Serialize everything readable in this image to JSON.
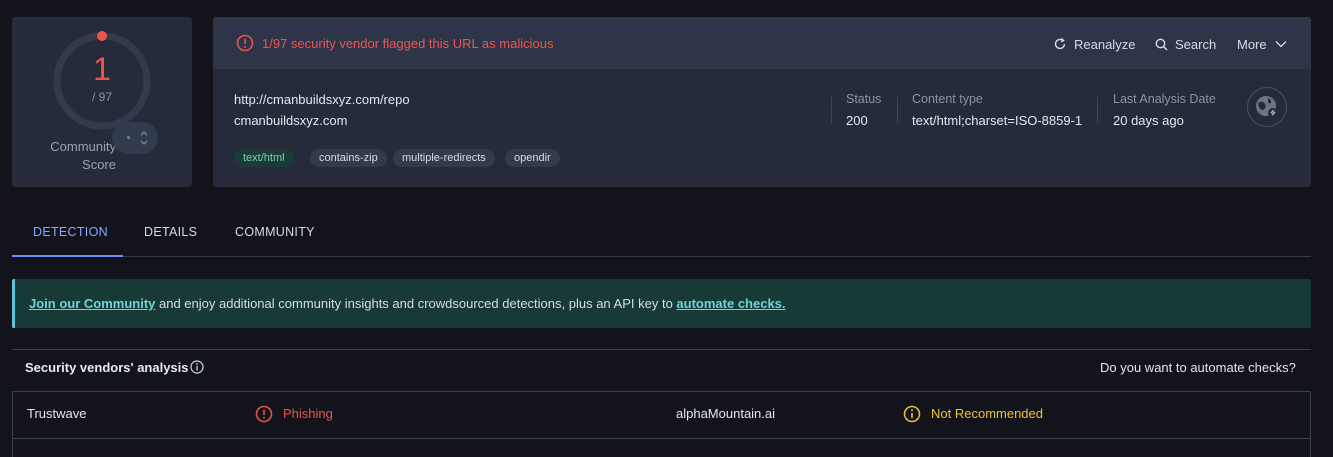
{
  "score": {
    "value": "1",
    "total": "/ 97",
    "community_label_line1": "Community",
    "community_label_line2": "Score"
  },
  "alert": {
    "text": "1/97 security vendor flagged this URL as malicious",
    "color": "#ef5350"
  },
  "actions": {
    "reanalyze": "Reanalyze",
    "search": "Search",
    "more": "More"
  },
  "target": {
    "url": "http://cmanbuildsxyz.com/repo",
    "domain": "cmanbuildsxyz.com",
    "tags": [
      "text/html",
      "contains-zip",
      "multiple-redirects",
      "opendir"
    ]
  },
  "meta": {
    "status_label": "Status",
    "status_value": "200",
    "content_type_label": "Content type",
    "content_type_value": "text/html;charset=ISO-8859-1",
    "last_analysis_label": "Last Analysis Date",
    "last_analysis_value": "20 days ago"
  },
  "tabs": [
    "DETECTION",
    "DETAILS",
    "COMMUNITY"
  ],
  "banner": {
    "link1": "Join our Community",
    "middle": " and enjoy additional community insights and crowdsourced detections, plus an API key to ",
    "link2": "automate checks."
  },
  "vendors": {
    "title": "Security vendors' analysis",
    "automate_question": "Do you want to automate checks?",
    "rows": [
      {
        "vendor_1": "Trustwave",
        "result_1": "Phishing",
        "result_1_color": "#ef5350",
        "vendor_2": "alphaMountain.ai",
        "result_2": "Not Recommended",
        "result_2_color": "#e8c43a"
      }
    ]
  },
  "icons": {
    "alert": "alert-circle-icon",
    "reanalyze": "refresh-icon",
    "search": "search-icon",
    "more": "chevron-down-icon",
    "globe": "globe-link-icon",
    "info": "info-icon"
  },
  "colors": {
    "accent": "#6f8cff",
    "danger": "#ef5350",
    "warning": "#e8c43a",
    "tag_green": "#6fd3b2"
  }
}
